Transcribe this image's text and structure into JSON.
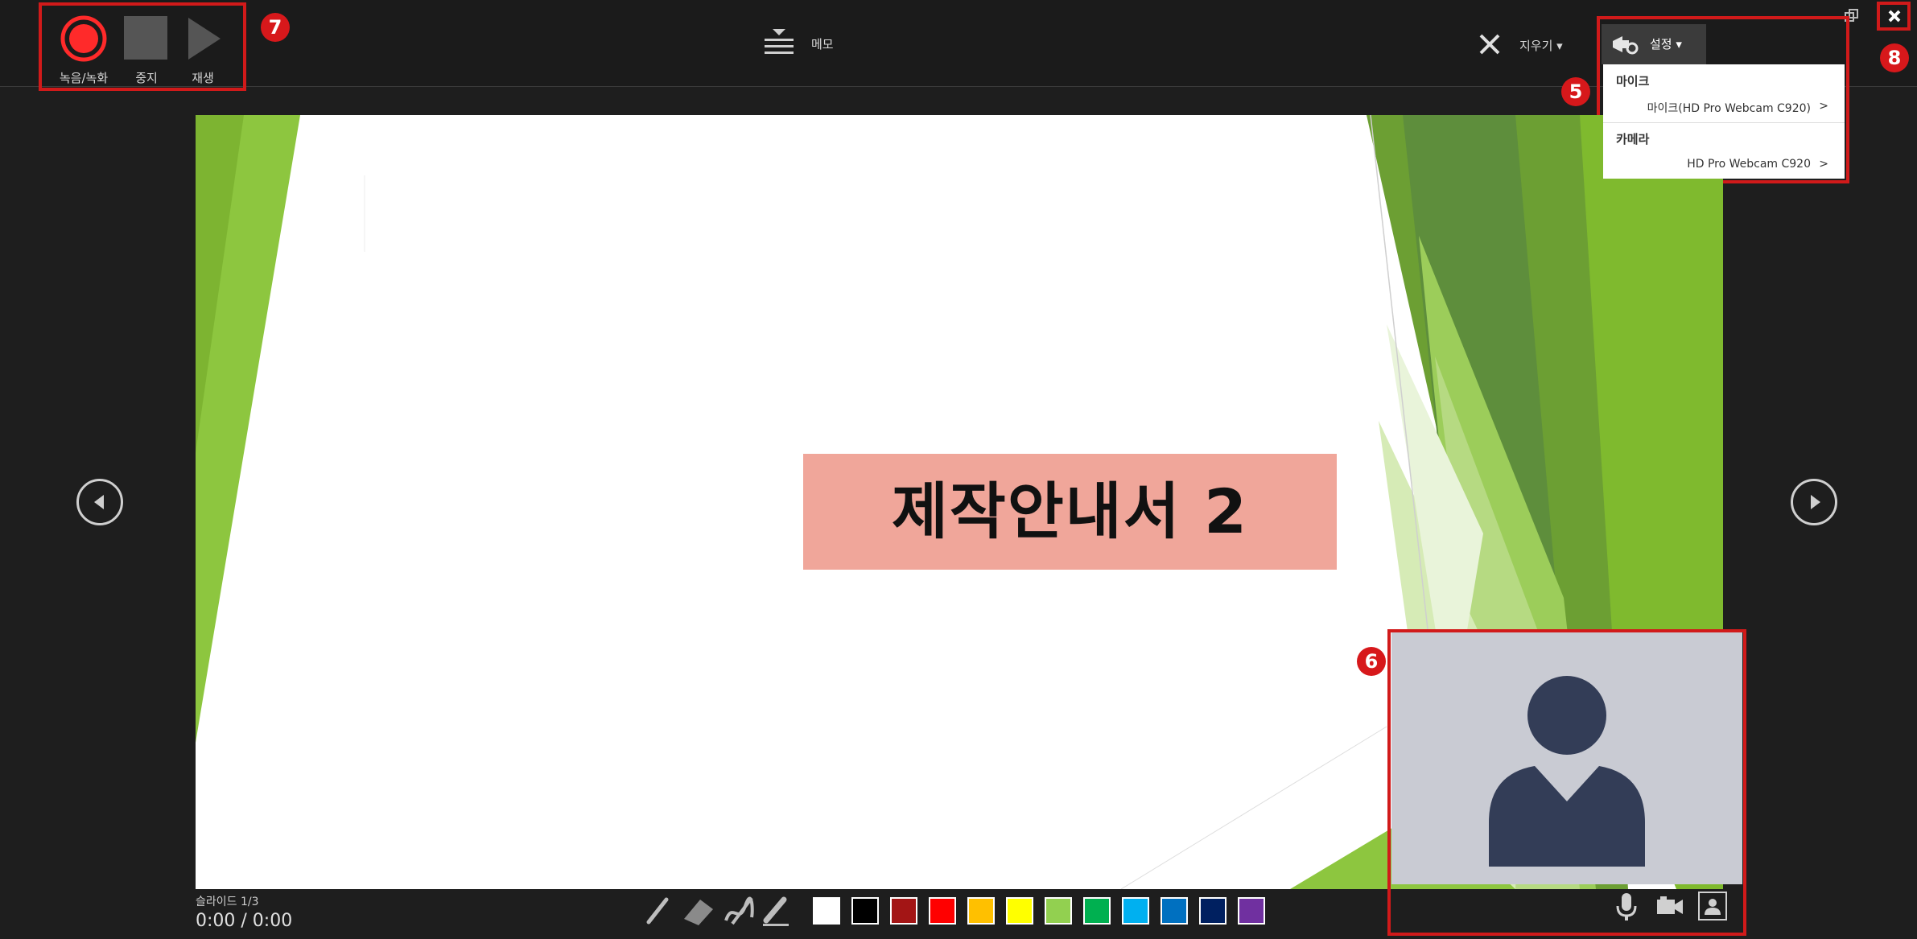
{
  "toolbar": {
    "record_label": "녹음/녹화",
    "stop_label": "중지",
    "play_label": "재생",
    "notes_label": "메모",
    "clear_label": "지우기 ▾",
    "settings_label": "설정 ▾"
  },
  "settings_menu": {
    "mic_header": "마이크",
    "mic_item": "마이크(HD Pro Webcam C920)",
    "camera_header": "카메라",
    "camera_item": "HD Pro Webcam C920"
  },
  "slide": {
    "title": "제작안내서 2",
    "number_text": "슬라이드 1/3",
    "timer": "0:00 / 0:00"
  },
  "callouts": {
    "record_badge": "7",
    "settings_badge": "5",
    "camera_badge": "6",
    "close_badge": "8"
  },
  "colors": {
    "accent_red": "#d7181b",
    "slide_green": "#7fba2e",
    "title_box": "#f0a69a"
  },
  "pen_colors": [
    "#ffffff",
    "#000000",
    "#a31515",
    "#ff0000",
    "#ffc000",
    "#ffff00",
    "#92d050",
    "#00b050",
    "#00b0f0",
    "#0070c0",
    "#002060",
    "#7030a0"
  ],
  "icons": [
    "record-icon",
    "stop-icon",
    "play-icon",
    "notes-icon",
    "clear-icon",
    "settings-camera-icon",
    "close-icon",
    "restore-icon",
    "prev-slide-icon",
    "next-slide-icon",
    "pen-icon",
    "eraser-icon",
    "ink-pen-icon",
    "highlighter-icon",
    "microphone-icon",
    "camera-toggle-icon",
    "camera-preview-icon",
    "avatar-icon"
  ]
}
